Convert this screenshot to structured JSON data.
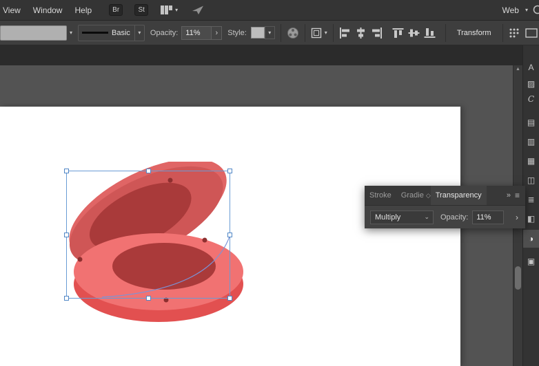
{
  "menubar": {
    "menus": [
      {
        "label": "View"
      },
      {
        "label": "Window"
      },
      {
        "label": "Help"
      }
    ],
    "bridge_label": "Br",
    "stock_label": "St",
    "workspace_label": "Web"
  },
  "controlbar": {
    "stroke_style": "Basic",
    "opacity_label": "Opacity:",
    "opacity_value": "11%",
    "style_label": "Style:",
    "transform_label": "Transform"
  },
  "panel": {
    "tabs": {
      "stroke": "Stroke",
      "gradient": "Gradie",
      "transparency": "Transparency"
    },
    "blend_mode": "Multiply",
    "opacity_label": "Opacity:",
    "opacity_value": "11%"
  },
  "icons": {
    "chevron_down": "▾",
    "chevron_right": "›",
    "select_chevron": "⌄",
    "overflow": "»",
    "panel_menu": "≡",
    "scroll_up": "▲",
    "gradient_tab_glyph": "◇"
  },
  "dock": {
    "items": [
      {
        "name": "character",
        "glyph": "A"
      },
      {
        "name": "swatches",
        "glyph": "▨"
      },
      {
        "name": "color",
        "glyph": "C"
      },
      {
        "name": "graphic-styles",
        "glyph": "▤"
      },
      {
        "name": "brushes",
        "glyph": "▥"
      },
      {
        "name": "symbols",
        "glyph": "▦"
      },
      {
        "name": "artboards",
        "glyph": "◫"
      },
      {
        "name": "layers",
        "glyph": "≣"
      },
      {
        "name": "gradient",
        "glyph": "◧"
      },
      {
        "name": "transparency",
        "glyph": "◑"
      },
      {
        "name": "links",
        "glyph": "▣"
      }
    ]
  },
  "artwork": {
    "colors": {
      "lid_highlight": "#e06565",
      "lid_main": "#cf5656",
      "lid_inner": "#a93a3a",
      "base_rim": "#e25050",
      "base_face": "#f17272",
      "base_inner": "#aa3a3a",
      "dot": "#8e2f2f",
      "path_highlight": "#7b93d8",
      "selection": "#699bd4"
    }
  }
}
